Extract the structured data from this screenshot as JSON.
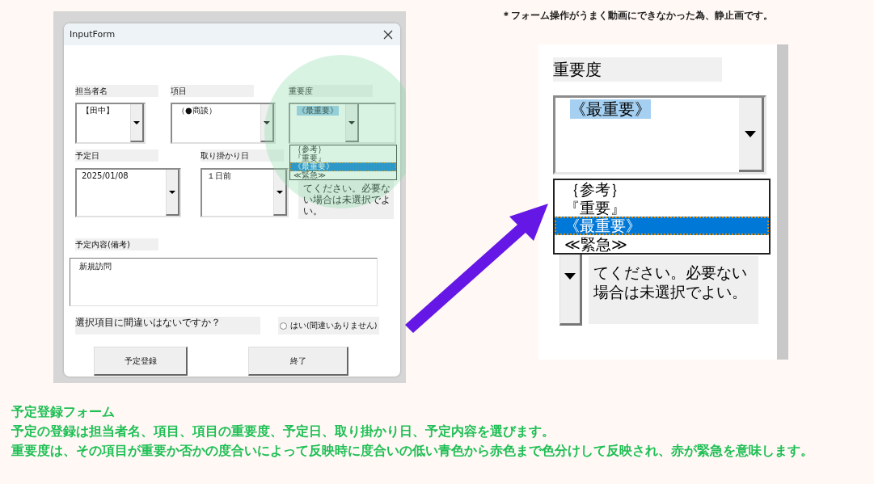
{
  "note": "＊フォーム操作がうまく動画にできなかった為、静止画です。",
  "form": {
    "title": "InputForm",
    "fields": [
      {
        "label": "担当者名",
        "value": "【田中】",
        "highlighted": false
      },
      {
        "label": "項目",
        "value": "（●商談）",
        "highlighted": false
      },
      {
        "label": "重要度",
        "value": "《最重要》",
        "highlighted": true
      },
      {
        "label": "予定日",
        "value": "2025/01/08",
        "highlighted": false
      },
      {
        "label": "取り掛かり日",
        "value": "１日前",
        "highlighted": false
      }
    ],
    "options": [
      {
        "label": "｛参考｝",
        "selected": false
      },
      {
        "label": "『重要』",
        "selected": false
      },
      {
        "label": "《最重要》",
        "selected": true
      },
      {
        "label": "≪緊急≫",
        "selected": false
      }
    ],
    "hint": "てください。必要ない場合は未選択でよい。",
    "remarks": {
      "label": "予定内容(備考)",
      "value": "新規訪問"
    },
    "confirm": {
      "question": "選択項目に間違いはないですか？",
      "option": "はい(間違いありません)",
      "checked": false
    },
    "buttons": [
      "予定登録",
      "終了"
    ]
  },
  "zoom": {
    "label": "重要度",
    "value": "《最重要》",
    "highlighted": true,
    "options": [
      {
        "label": "｛参考｝",
        "selected": false
      },
      {
        "label": "『重要』",
        "selected": false
      },
      {
        "label": "《最重要》",
        "selected": true
      },
      {
        "label": "≪緊急≫",
        "selected": false
      }
    ],
    "hint": "てください。必要ない場合は未選択でよい。"
  },
  "caption": {
    "title": "予定登録フォーム",
    "paragraphs": [
      "予定の登録は担当者名、項目、項目の重要度、予定日、取り掛かり日、予定内容を選びます。",
      "重要度は、その項目が重要か否かの度合いによって反映時に度合いの低い青色から赤色まで色分けして反映され、赤が緊急を意味します。"
    ]
  }
}
